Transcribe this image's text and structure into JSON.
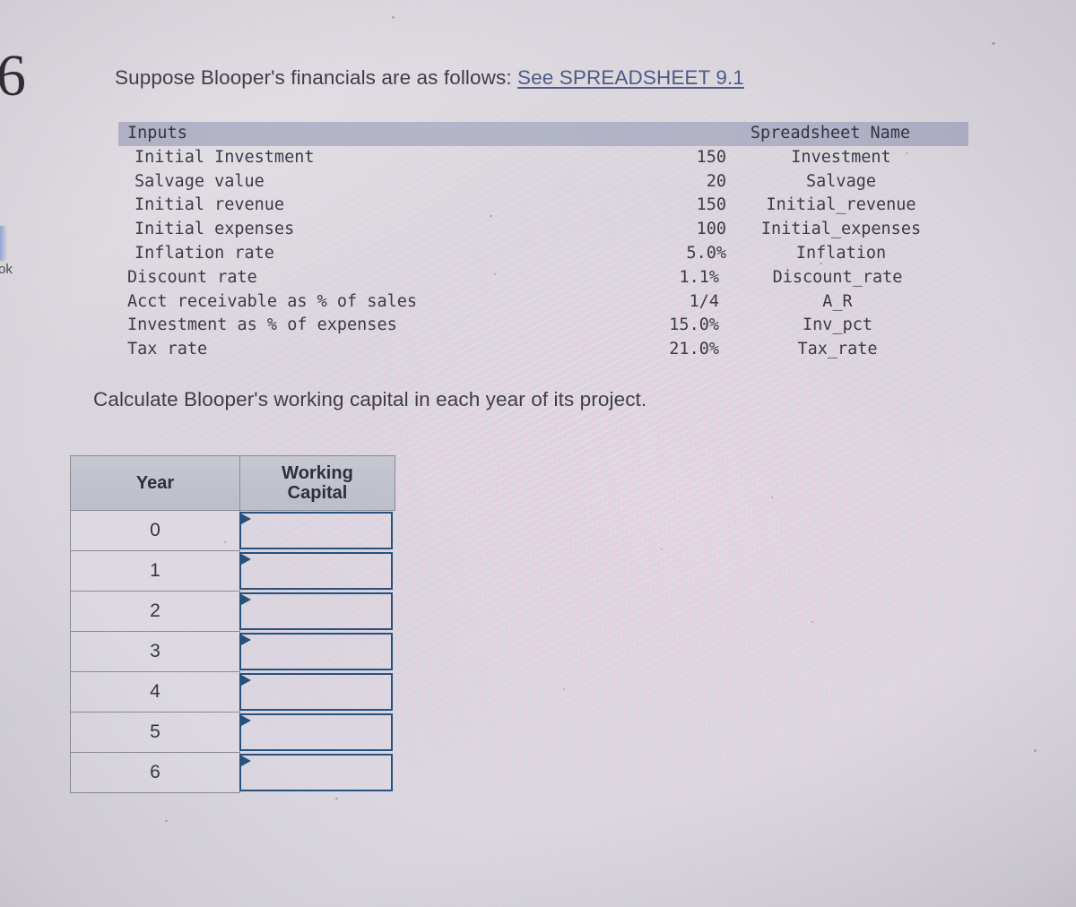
{
  "page": {
    "number": "6",
    "edge_label": "ok",
    "background_color": "#dcd8de"
  },
  "prompt": {
    "intro_text": "Suppose Blooper's financials are as follows: ",
    "link_text": "See SPREADSHEET 9.1",
    "link_color": "#4f5b86",
    "task_text": "Calculate Blooper's working capital in each year of its project."
  },
  "inputs_table": {
    "headers": {
      "label": "Inputs",
      "value": "",
      "spreadsheet_name": "Spreadsheet Name"
    },
    "header_bg": "#a4a7c0",
    "rows": [
      {
        "label": "Initial Investment",
        "value": "150",
        "name": "Investment",
        "indent": true
      },
      {
        "label": "Salvage value",
        "value": "20",
        "name": "Salvage",
        "indent": true
      },
      {
        "label": "Initial revenue",
        "value": "150",
        "name": "Initial_revenue",
        "indent": true
      },
      {
        "label": "Initial expenses",
        "value": "100",
        "name": "Initial_expenses",
        "indent": true
      },
      {
        "label": "Inflation rate",
        "value": "5.0%",
        "name": "Inflation",
        "indent": true
      },
      {
        "label": "Discount rate",
        "value": "1.1%",
        "name": "Discount_rate",
        "indent": false
      },
      {
        "label": "Acct receivable as % of sales",
        "value": "1/4",
        "name": "A_R",
        "indent": false
      },
      {
        "label": "Investment as % of expenses",
        "value": "15.0%",
        "name": "Inv_pct",
        "indent": false
      },
      {
        "label": "Tax rate",
        "value": "21.0%",
        "name": "Tax_rate",
        "indent": false
      }
    ]
  },
  "working_capital_table": {
    "columns": {
      "year": "Year",
      "working_capital_line1": "Working",
      "working_capital_line2": "Capital"
    },
    "header_bg": "#c0c2cc",
    "answer_border_color": "#27517d",
    "rows": [
      {
        "year": "0",
        "working_capital": ""
      },
      {
        "year": "1",
        "working_capital": ""
      },
      {
        "year": "2",
        "working_capital": ""
      },
      {
        "year": "3",
        "working_capital": ""
      },
      {
        "year": "4",
        "working_capital": ""
      },
      {
        "year": "5",
        "working_capital": ""
      },
      {
        "year": "6",
        "working_capital": ""
      }
    ]
  }
}
